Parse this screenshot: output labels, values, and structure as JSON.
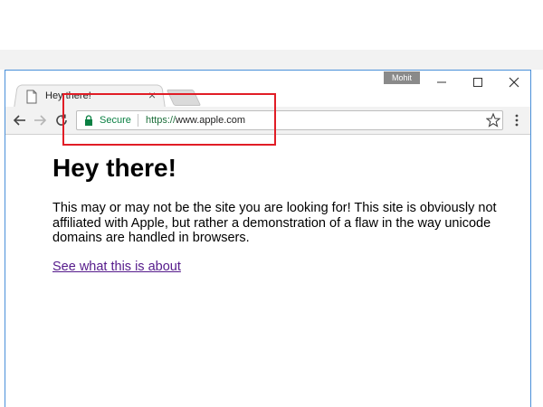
{
  "browser": {
    "tab": {
      "title": "Hey there!"
    },
    "user_badge": "Mohit",
    "address_bar": {
      "secure_label": "Secure",
      "url_scheme": "https://",
      "url_host": "www.apple.com"
    }
  },
  "page": {
    "heading": "Hey there!",
    "paragraph": "This may or may not be the site you are looking for! This site is obviously not affiliated with Apple, but rather a demonstration of a flaw in the way unicode domains are handled in browsers.",
    "link_text": "See what this is about"
  },
  "colors": {
    "secure_green": "#0b8043",
    "highlight_red": "#e11d26",
    "link_visited": "#551a8b"
  },
  "icons": [
    "page-icon",
    "close-icon",
    "back-arrow-icon",
    "forward-arrow-icon",
    "reload-icon",
    "lock-icon",
    "star-icon",
    "menu-dots-icon",
    "minimize-icon",
    "maximize-icon",
    "window-close-icon"
  ]
}
